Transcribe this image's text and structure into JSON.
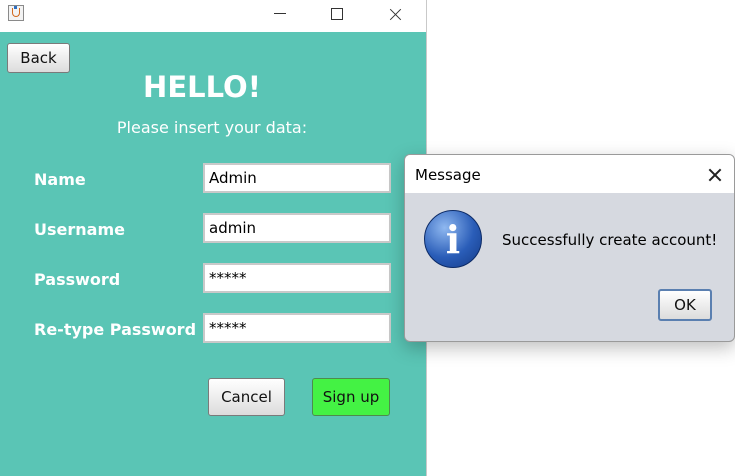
{
  "window": {
    "buttons": {
      "back": "Back",
      "cancel": "Cancel",
      "signup": "Sign up"
    },
    "heading": "HELLO!",
    "subheading": "Please insert your data:",
    "form": [
      {
        "label": "Name",
        "value": "Admin"
      },
      {
        "label": "Username",
        "value": "admin"
      },
      {
        "label": "Password",
        "value": "*****"
      },
      {
        "label": "Re-type Password",
        "value": "*****"
      }
    ],
    "colors": {
      "background": "#5ac5b5",
      "signup_button": "#44f244"
    }
  },
  "dialog": {
    "title": "Message",
    "icon": "info-icon",
    "icon_glyph": "i",
    "message": "Successfully create account!",
    "ok": "OK"
  }
}
